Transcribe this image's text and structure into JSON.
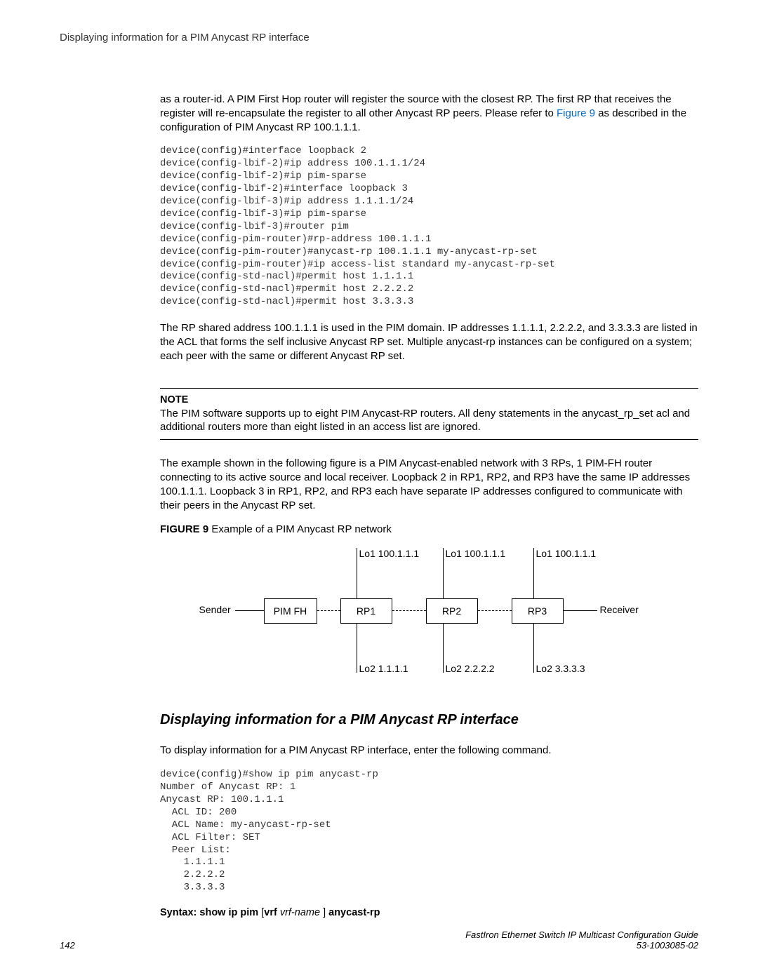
{
  "header": {
    "title": "Displaying information for a PIM Anycast RP interface"
  },
  "para1": "as a router-id. A PIM First Hop router will register the source with the closest RP. The first RP that receives the register will re-encapsulate the register to all other Anycast RP peers. Please refer to ",
  "para1_link": "Figure 9",
  "para1_after": " as described in the configuration of PIM Anycast RP 100.1.1.1.",
  "code1": "device(config)#interface loopback 2\ndevice(config-lbif-2)#ip address 100.1.1.1/24\ndevice(config-lbif-2)#ip pim-sparse\ndevice(config-lbif-2)#interface loopback 3\ndevice(config-lbif-3)#ip address 1.1.1.1/24\ndevice(config-lbif-3)#ip pim-sparse\ndevice(config-lbif-3)#router pim\ndevice(config-pim-router)#rp-address 100.1.1.1\ndevice(config-pim-router)#anycast-rp 100.1.1.1 my-anycast-rp-set\ndevice(config-pim-router)#ip access-list standard my-anycast-rp-set\ndevice(config-std-nacl)#permit host 1.1.1.1\ndevice(config-std-nacl)#permit host 2.2.2.2\ndevice(config-std-nacl)#permit host 3.3.3.3",
  "para2": "The RP shared address 100.1.1.1 is used in the PIM domain. IP addresses 1.1.1.1, 2.2.2.2, and 3.3.3.3 are listed in the ACL that forms the self inclusive Anycast RP set. Multiple anycast-rp instances can be configured on a system; each peer with the same or different Anycast RP set.",
  "note": {
    "heading": "NOTE",
    "body": "The PIM software supports up to eight PIM Anycast-RP routers. All deny statements in the anycast_rp_set acl and additional routers more than eight listed in an access list are ignored."
  },
  "para3": "The example shown in the following figure is a PIM Anycast-enabled network with 3 RPs, 1 PIM-FH router connecting to its active source and local receiver. Loopback 2 in RP1, RP2, and RP3 have the same IP addresses 100.1.1.1. Loopback 3 in RP1, RP2, and RP3 each have separate IP addresses configured to communicate with their peers in the Anycast RP set.",
  "figure": {
    "label": "FIGURE 9",
    "caption": "Example of a PIM Anycast RP network"
  },
  "diagram": {
    "sender": "Sender",
    "pimfh": "PIM FH",
    "rp1": "RP1",
    "rp2": "RP2",
    "rp3": "RP3",
    "receiver": "Receiver",
    "lo1a": "Lo1 100.1.1.1",
    "lo1b": "Lo1 100.1.1.1",
    "lo1c": "Lo1 100.1.1.1",
    "lo2a": "Lo2 1.1.1.1",
    "lo2b": "Lo2 2.2.2.2",
    "lo2c": "Lo2 3.3.3.3"
  },
  "section_title": "Displaying information for a PIM Anycast RP interface",
  "para4": "To display information for a PIM Anycast RP interface, enter the following command.",
  "code2": "device(config)#show ip pim anycast-rp\nNumber of Anycast RP: 1\nAnycast RP: 100.1.1.1\n  ACL ID: 200\n  ACL Name: my-anycast-rp-set\n  ACL Filter: SET\n  Peer List:\n    1.1.1.1\n    2.2.2.2\n    3.3.3.3",
  "syntax": {
    "pre": "Syntax: show ip pim ",
    "bracket_open": "[",
    "vrf": "vrf ",
    "vrfname": "vrf-name ",
    "bracket_close": "]",
    "post": " anycast-rp"
  },
  "footer": {
    "page": "142",
    "guide": "FastIron Ethernet Switch IP Multicast Configuration Guide",
    "docnum": "53-1003085-02"
  }
}
